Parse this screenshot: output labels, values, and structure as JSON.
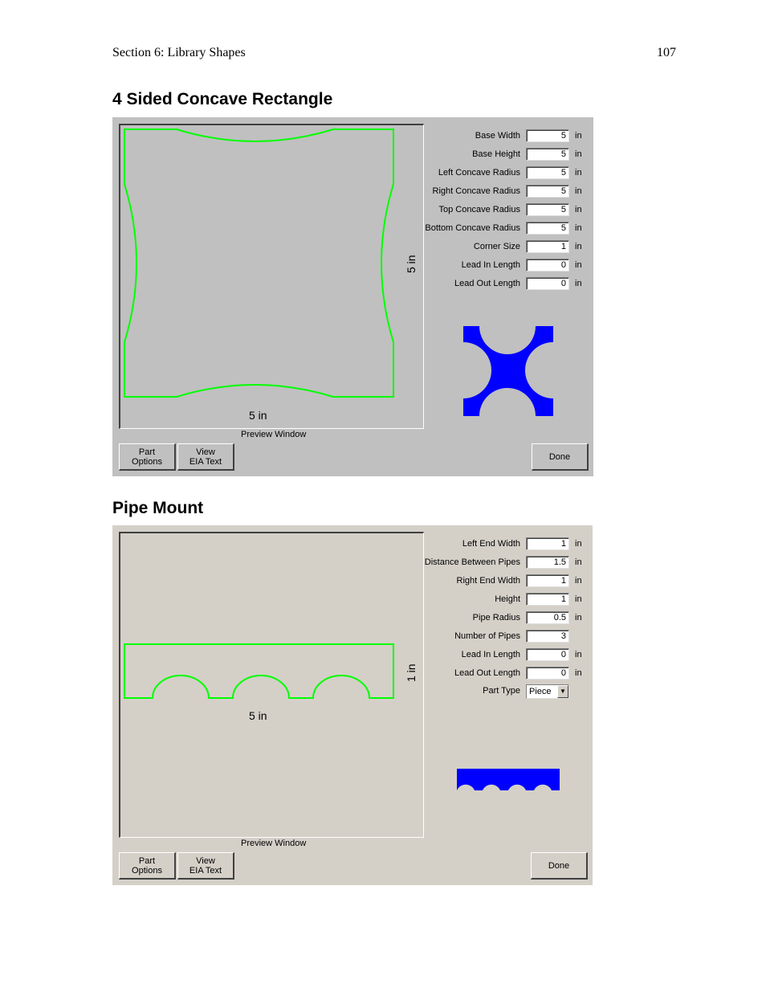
{
  "page": {
    "header_left": "Section 6: Library Shapes",
    "header_right": "107"
  },
  "colors": {
    "outline": "#00ff00",
    "icon_fill": "#0000ff",
    "panel1_bg": "#c0c0c0",
    "panel2_bg": "#d4d0c8"
  },
  "concave": {
    "title": "4 Sided Concave Rectangle",
    "preview_caption": "Preview Window",
    "dim_width": "5 in",
    "dim_height": "5 in",
    "fields": [
      {
        "label": "Base Width",
        "value": "5",
        "unit": "in"
      },
      {
        "label": "Base Height",
        "value": "5",
        "unit": "in"
      },
      {
        "label": "Left Concave Radius",
        "value": "5",
        "unit": "in"
      },
      {
        "label": "Right Concave Radius",
        "value": "5",
        "unit": "in"
      },
      {
        "label": "Top Concave Radius",
        "value": "5",
        "unit": "in"
      },
      {
        "label": "Bottom Concave Radius",
        "value": "5",
        "unit": "in"
      },
      {
        "label": "Corner Size",
        "value": "1",
        "unit": "in"
      },
      {
        "label": "Lead In Length",
        "value": "0",
        "unit": "in"
      },
      {
        "label": "Lead Out Length",
        "value": "0",
        "unit": "in"
      }
    ],
    "buttons": {
      "part_options": "Part\nOptions",
      "view_eia": "View\nEIA Text",
      "done": "Done"
    }
  },
  "pipe": {
    "title": "Pipe Mount",
    "preview_caption": "Preview Window",
    "dim_width": "5 in",
    "dim_height": "1 in",
    "fields": [
      {
        "label": "Left End Width",
        "value": "1",
        "unit": "in"
      },
      {
        "label": "Distance Between Pipes",
        "value": "1.5",
        "unit": "in"
      },
      {
        "label": "Right End Width",
        "value": "1",
        "unit": "in"
      },
      {
        "label": "Height",
        "value": "1",
        "unit": "in"
      },
      {
        "label": "Pipe Radius",
        "value": "0.5",
        "unit": "in"
      },
      {
        "label": "Number of Pipes",
        "value": "3",
        "unit": ""
      },
      {
        "label": "Lead In Length",
        "value": "0",
        "unit": "in"
      },
      {
        "label": "Lead Out Length",
        "value": "0",
        "unit": "in"
      }
    ],
    "part_type": {
      "label": "Part Type",
      "value": "Piece"
    },
    "buttons": {
      "part_options": "Part\nOptions",
      "view_eia": "View\nEIA Text",
      "done": "Done"
    }
  }
}
